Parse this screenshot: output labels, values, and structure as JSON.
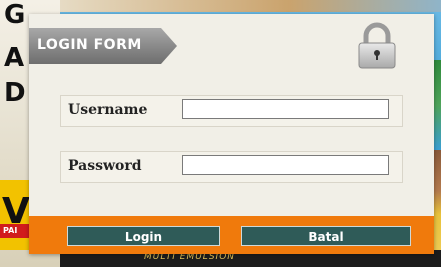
{
  "background": {
    "poster_letters": [
      "G",
      "A",
      "D"
    ],
    "poster_big_letter": "V",
    "poster_tag": "PAI",
    "strip_text": "MULTI EMULSION"
  },
  "login_form": {
    "title": "LOGIN FORM",
    "lock_icon": "padlock-icon",
    "username": {
      "label": "Username",
      "value": "",
      "placeholder": ""
    },
    "password": {
      "label": "Password",
      "value": "",
      "placeholder": ""
    },
    "login_button": "Login",
    "cancel_button": "Batal"
  },
  "colors": {
    "panel": "#f1efe7",
    "header_tag": "#8c8c8c",
    "footer": "#f07a0c",
    "button": "#2f5b58"
  }
}
